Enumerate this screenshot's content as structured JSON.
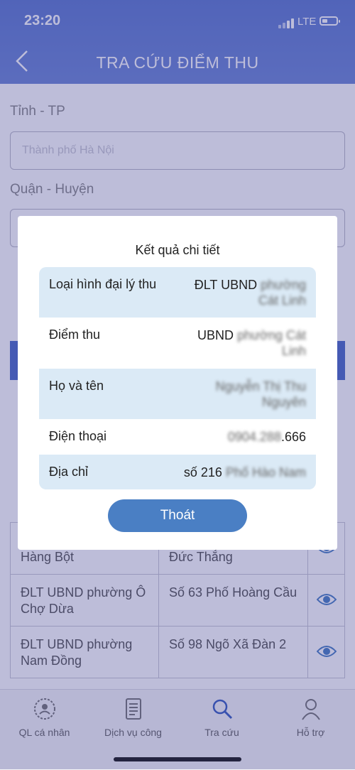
{
  "status_bar": {
    "time": "23:20",
    "network": "LTE"
  },
  "header": {
    "title": "TRA CỨU ĐIỂM THU"
  },
  "form": {
    "province_label": "Tỉnh - TP",
    "province_value": "Thành phố Hà Nội",
    "district_label": "Quận - Huyện"
  },
  "table": {
    "rows": [
      {
        "name": "ĐLT UBND phường Hàng Bột",
        "address": "Số 60 ngõ 221 Tôn Đức Thắng"
      },
      {
        "name": "ĐLT UBND phường Ô Chợ Dừa",
        "address": "Số 63 Phố Hoàng Cầu"
      },
      {
        "name": "ĐLT UBND phường Nam Đồng",
        "address": "Số 98 Ngõ Xã Đàn 2"
      }
    ]
  },
  "tabs": [
    {
      "label": "QL cá nhân",
      "icon": "person-badge-icon"
    },
    {
      "label": "Dịch vụ công",
      "icon": "document-list-icon"
    },
    {
      "label": "Tra cứu",
      "icon": "search-icon"
    },
    {
      "label": "Hỗ trợ",
      "icon": "support-person-icon"
    }
  ],
  "modal": {
    "title": "Kết quả chi tiết",
    "rows": [
      {
        "key": "Loại hình đại lý thu",
        "value_a": "ĐLT UBND",
        "value_b": "phường Cát Linh"
      },
      {
        "key": "Điểm thu",
        "value_a": "UBND",
        "value_b": "phường Cát Linh"
      },
      {
        "key": "Họ và tên",
        "value_a": "",
        "value_b": "Nguyễn Thị Thu Nguyên"
      },
      {
        "key": "Điện thoại",
        "value_a": "0904.288",
        "value_b": ".666"
      },
      {
        "key": "Địa chỉ",
        "value_a": "số 216",
        "value_b": "Phố Hào Nam"
      }
    ],
    "close_label": "Thoát"
  },
  "colors": {
    "header": "#6a84d4",
    "accent": "#4a7fc4",
    "row_shade": "#dbeaf6"
  }
}
